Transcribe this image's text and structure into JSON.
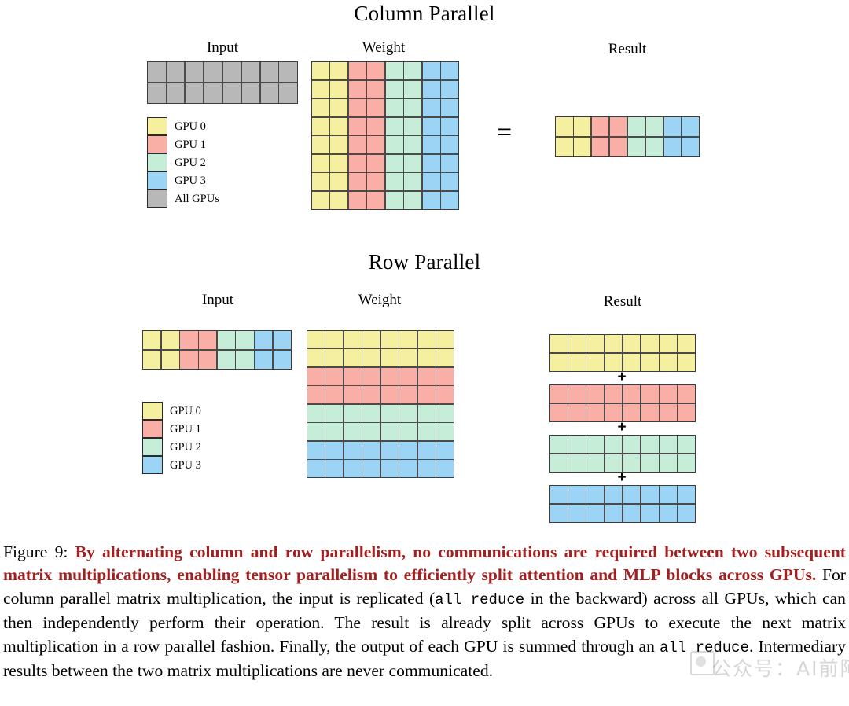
{
  "figure": {
    "sections": [
      {
        "id": "column-parallel",
        "title": "Column Parallel",
        "input_label": "Input",
        "weight_label": "Weight",
        "result_label": "Result",
        "equals_symbol": "="
      },
      {
        "id": "row-parallel",
        "title": "Row Parallel",
        "input_label": "Input",
        "weight_label": "Weight",
        "result_label": "Result",
        "equals_symbol": "=",
        "plus_symbol": "+"
      }
    ]
  },
  "colors": {
    "gpu0": "#F5F0A0",
    "gpu1": "#FAAFA6",
    "gpu2": "#C5EDD8",
    "gpu3": "#9BD4F5",
    "all_gpus": "#B8B8B8",
    "grid_line": "#3b3b3b",
    "caption_highlight": "#A32020"
  },
  "legends": {
    "column_parallel": [
      {
        "label": "GPU 0",
        "color_key": "gpu0"
      },
      {
        "label": "GPU 1",
        "color_key": "gpu1"
      },
      {
        "label": "GPU 2",
        "color_key": "gpu2"
      },
      {
        "label": "GPU 3",
        "color_key": "gpu3"
      },
      {
        "label": "All GPUs",
        "color_key": "all_gpus"
      }
    ],
    "row_parallel": [
      {
        "label": "GPU 0",
        "color_key": "gpu0"
      },
      {
        "label": "GPU 1",
        "color_key": "gpu1"
      },
      {
        "label": "GPU 2",
        "color_key": "gpu2"
      },
      {
        "label": "GPU 3",
        "color_key": "gpu3"
      }
    ]
  },
  "matrices": {
    "column_input": {
      "rows": 2,
      "cols": 8,
      "split": "none",
      "fill": [
        "all_gpus"
      ]
    },
    "column_weight": {
      "rows": 8,
      "cols": 8,
      "split": "columns",
      "groups": [
        "gpu0",
        "gpu1",
        "gpu2",
        "gpu3"
      ],
      "cols_per_group": 2
    },
    "column_result": {
      "rows": 2,
      "cols": 8,
      "split": "columns",
      "groups": [
        "gpu0",
        "gpu1",
        "gpu2",
        "gpu3"
      ],
      "cols_per_group": 2
    },
    "row_input": {
      "rows": 2,
      "cols": 8,
      "split": "columns",
      "groups": [
        "gpu0",
        "gpu1",
        "gpu2",
        "gpu3"
      ],
      "cols_per_group": 2
    },
    "row_weight": {
      "rows": 8,
      "cols": 8,
      "split": "rows",
      "groups": [
        "gpu0",
        "gpu1",
        "gpu2",
        "gpu3"
      ],
      "rows_per_group": 2
    },
    "row_results": [
      {
        "rows": 2,
        "cols": 8,
        "fill": "gpu0"
      },
      {
        "rows": 2,
        "cols": 8,
        "fill": "gpu1"
      },
      {
        "rows": 2,
        "cols": 8,
        "fill": "gpu2"
      },
      {
        "rows": 2,
        "cols": 8,
        "fill": "gpu3"
      }
    ]
  },
  "caption": {
    "prefix": "Figure 9: ",
    "highlight": "By alternating column and row parallelism, no communications are required between two subsequent matrix multiplications, enabling tensor parallelism to efficiently split attention and MLP blocks across GPUs.",
    "body_1": " For column parallel matrix multiplication, the input is replicated (",
    "mono_1": "all_reduce",
    "body_2": " in the backward) across all GPUs, which can then independently perform their operation. The result is already split across GPUs to execute the next matrix multiplication in a row parallel fashion. Finally, the output of each GPU is summed through an ",
    "mono_2": "all_reduce",
    "body_3": ". Intermediary results between the two matrix multiplications are never communicated."
  },
  "watermark": {
    "text": "公众号：AI前阿谈"
  }
}
